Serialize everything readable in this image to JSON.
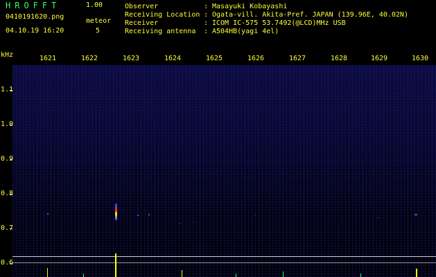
{
  "app": {
    "title": "HROFFT",
    "version": "1.00",
    "file_name": "0410191620.png",
    "date_time": "04.10.19 16:20",
    "meteor_label": "meteor",
    "meteor_count": "5"
  },
  "info": [
    {
      "label": "Observer",
      "value": "Masayuki Kobayashi"
    },
    {
      "label": "Receiving Location",
      "value": "Ogata-vill. Akita-Pref. JAPAN (139.96E, 40.02N)"
    },
    {
      "label": "Receiver",
      "value": "ICOM IC-575 53.7492(@LCD)MHz USB"
    },
    {
      "label": "Receiving antenna",
      "value": "A504HB(yagi 4el)"
    }
  ],
  "axis": {
    "y_unit": "kHz",
    "time_labels": [
      "1621",
      "1622",
      "1623",
      "1624",
      "1625",
      "1626",
      "1627",
      "1628",
      "1629",
      "1630"
    ],
    "freq_labels": [
      "1.1",
      "1.0",
      "0.9",
      "0.8",
      "0.7",
      "0.6"
    ]
  },
  "colors": {
    "text_yellow": "#ffff33",
    "text_green": "#33ff66",
    "background": "#000000",
    "noise_blue": "#0c0c44",
    "meteor_red": "#ff3333",
    "echo_blue": "#3355ff"
  }
}
